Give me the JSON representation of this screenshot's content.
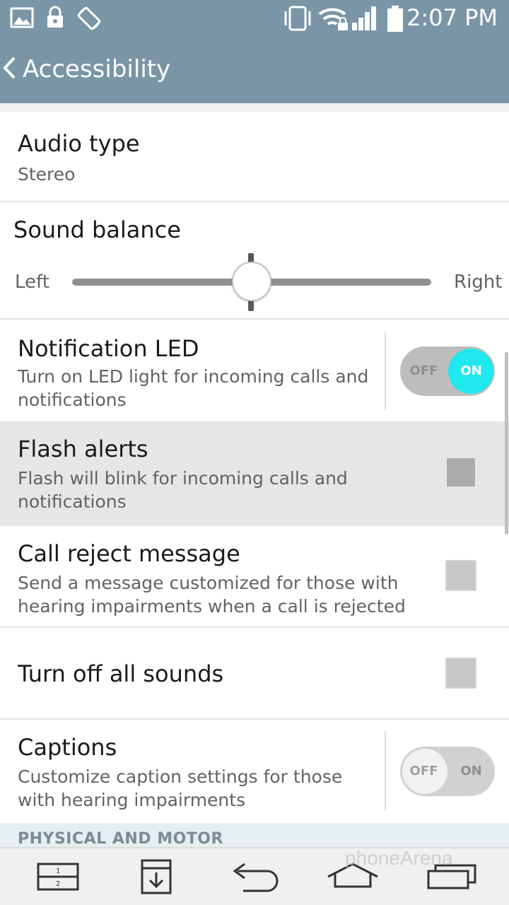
{
  "status_bar": {
    "time": "2:07 PM",
    "icons": [
      "gallery-icon",
      "lock-icon",
      "rotation-icon",
      "vibrate-icon",
      "wifi-locked-icon",
      "signal-icon",
      "battery-icon"
    ]
  },
  "action_bar": {
    "title": "Accessibility",
    "back_icon": "chevron-left-icon"
  },
  "settings": {
    "audio_type": {
      "title": "Audio type",
      "summary": "Stereo"
    },
    "sound_balance": {
      "title": "Sound balance",
      "left_label": "Left",
      "right_label": "Right",
      "value": 0.5
    },
    "notification_led": {
      "title": "Notification LED",
      "summary": "Turn on LED light for incoming calls and notifications",
      "off_label": "OFF",
      "on_label": "ON",
      "state": "on"
    },
    "flash_alerts": {
      "title": "Flash alerts",
      "summary": "Flash will blink for incoming calls and notifications",
      "checked": false
    },
    "call_reject_message": {
      "title": "Call reject message",
      "summary": "Send a message customized for those with hearing impairments when a call is rejected",
      "checked": false
    },
    "turn_off_all_sounds": {
      "title": "Turn off all sounds",
      "checked": false
    },
    "captions": {
      "title": "Captions",
      "summary": "Customize caption settings for those with hearing impairments",
      "off_label": "OFF",
      "on_label": "ON",
      "state": "off"
    }
  },
  "section_header": "PHYSICAL AND MOTOR",
  "nav_bar": {
    "buttons": [
      "dual-window-icon",
      "notes-download-icon",
      "back-arrow-icon",
      "home-icon",
      "recent-apps-icon"
    ]
  },
  "watermark": "phoneArena",
  "colors": {
    "header_bg": "#7a95a6",
    "toggle_on": "#1fe8ee",
    "highlight_row": "#e6e6e6"
  }
}
